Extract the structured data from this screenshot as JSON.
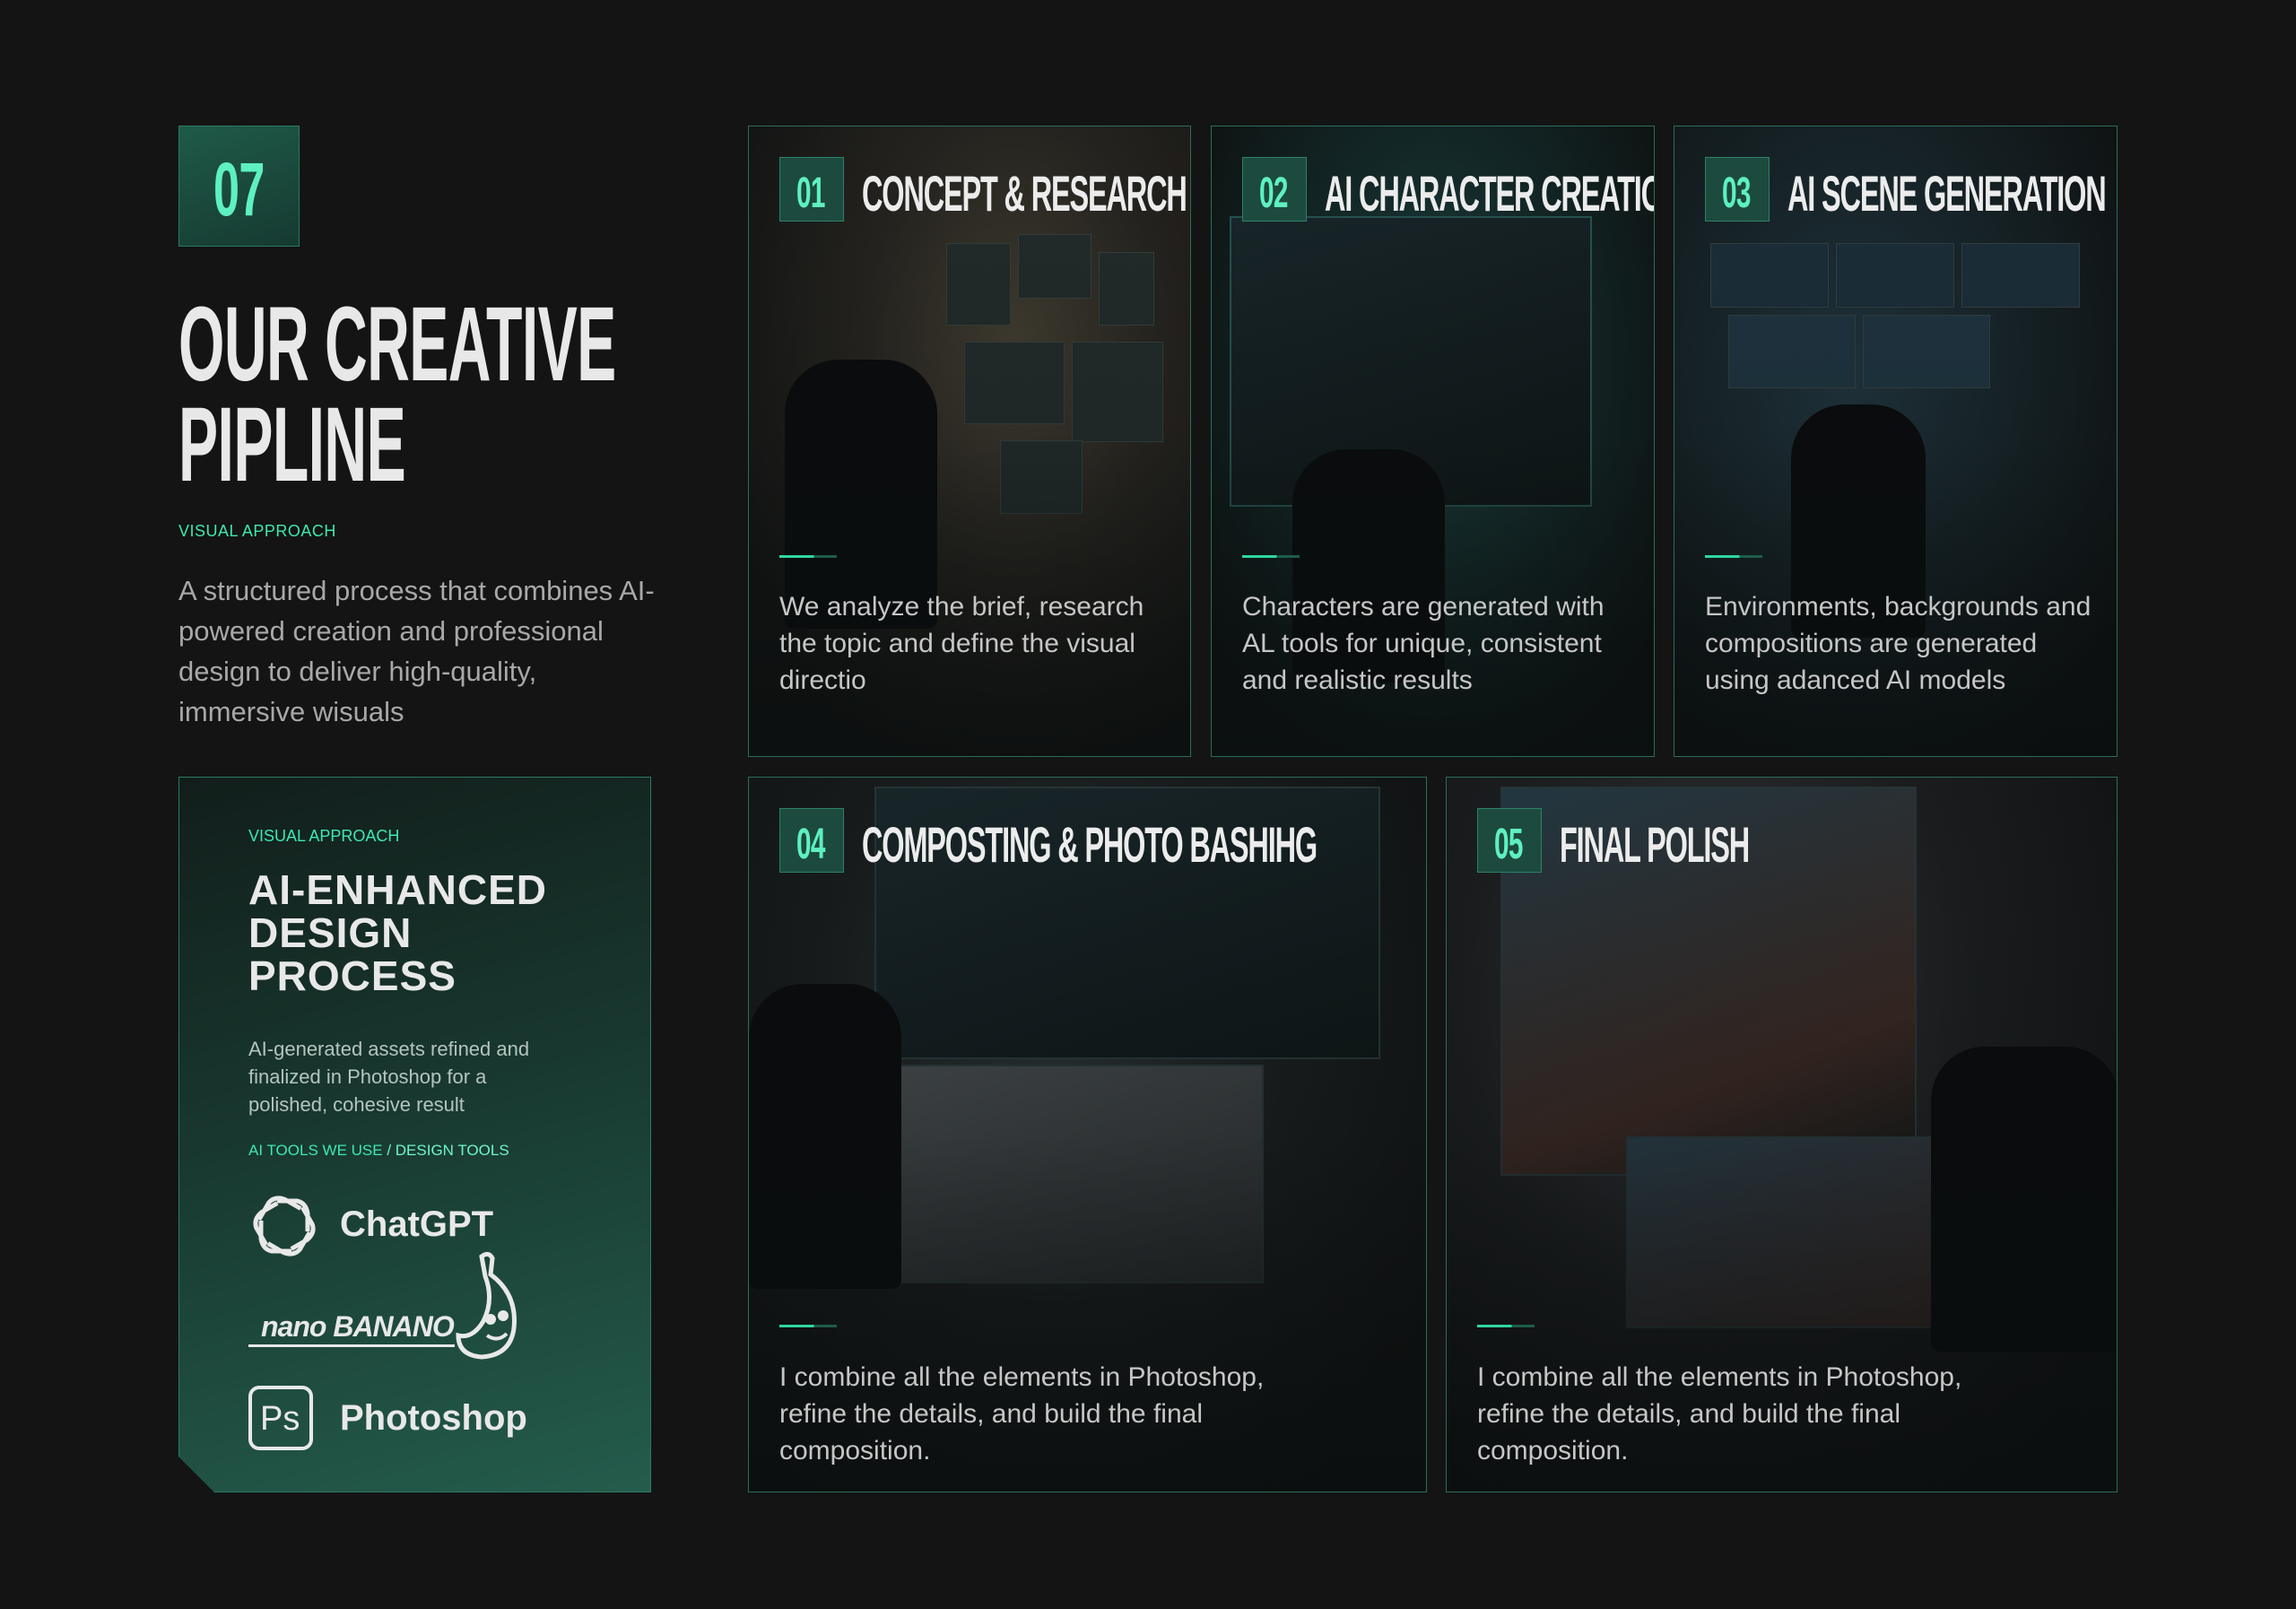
{
  "section": {
    "number": "07",
    "title_line1": "OUR CREATIVE",
    "title_line2": "PIPLINE",
    "subtitle": "VISUAL APPROACH",
    "intro": "A structured process that combines AI-powered creation and professional design to deliver high-quality, immersive wisuals"
  },
  "tools_panel": {
    "label": "VISUAL APPROACH",
    "title": "AI-ENHANCED DESIGN PROCESS",
    "description": "AI-generated assets refined and finalized in Photoshop for a polished, cohesive result",
    "tools_label_a": "AI TOOLS WE USE",
    "tools_label_sep": " / ",
    "tools_label_b": "DESIGN TOOLS",
    "tools": [
      "ChatGPT",
      "nano BANANO",
      "Photoshop"
    ],
    "photoshop_badge": "Ps"
  },
  "cards": [
    {
      "num": "01",
      "title": "CONCEPT & RESEARCH",
      "text": "We analyze the brief, research the topic and define the visual directio"
    },
    {
      "num": "02",
      "title": "AI CHARACTER CREATION",
      "text": "Characters are generated with AL tools for unique, consistent and realistic results"
    },
    {
      "num": "03",
      "title": "AI SCENE GENERATION",
      "text": "Environments, backgrounds and compositions are generated using adanced AI models"
    },
    {
      "num": "04",
      "title": "COMPOSTING & PHOTO BASHIHG",
      "text": "I combine all the elements in Photoshop, refine the details, and build the final composition."
    },
    {
      "num": "05",
      "title": "FINAL POLISH",
      "text": "I combine all the elements in Photoshop, refine the details, and build the final composition."
    }
  ],
  "colors": {
    "background": "#141414",
    "accent": "#3ee8b0",
    "panel": "#1d4a3e",
    "border": "#2a6e5a"
  },
  "icons": [
    "chatgpt-logo-icon",
    "banana-mascot-icon",
    "photoshop-logo-icon"
  ]
}
